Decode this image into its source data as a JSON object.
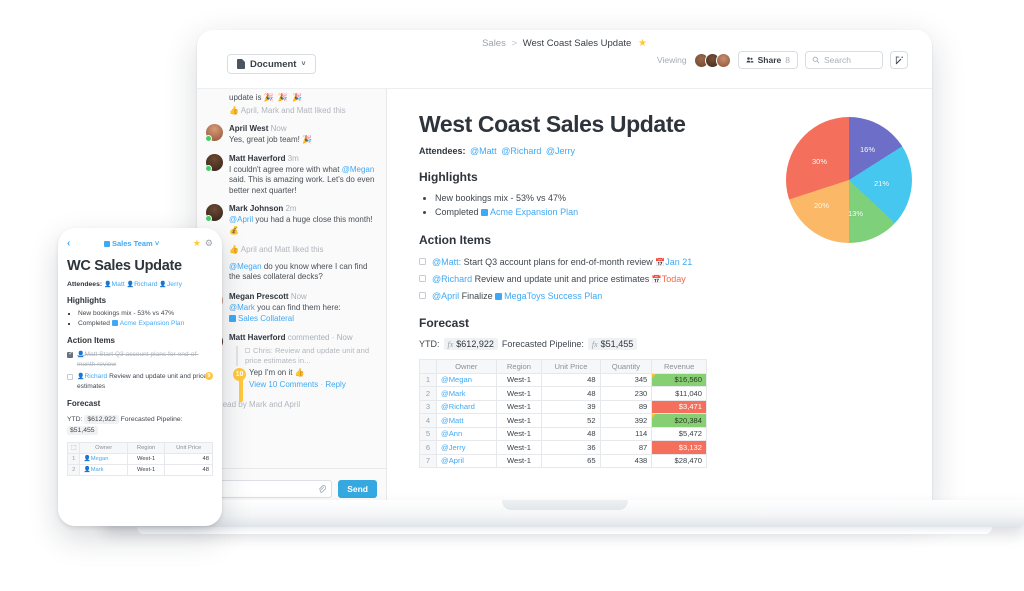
{
  "laptop": {
    "breadcrumb": {
      "root": "Sales",
      "separator": ">",
      "current": "West Coast Sales Update",
      "star": "★"
    },
    "doc_type_selector": {
      "label": "Document",
      "caret": "˅"
    },
    "toolbar": {
      "viewing_label": "Viewing",
      "share_label": "Share",
      "share_count": "8",
      "search_placeholder": "Search",
      "edit_icon": "compose-icon"
    },
    "chat": {
      "partial_message": {
        "text": "update is",
        "emoji": "🎉 🎉 🎉"
      },
      "partial_liked": "April, Mark and Matt liked this",
      "messages": [
        {
          "name": "April West",
          "time": "Now",
          "text": "Yes, great job team! 🎉",
          "avatar": "a-april"
        },
        {
          "name": "Matt Haverford",
          "time": "3m",
          "text_pre": "I couldn't agree more with what ",
          "mention": "@Megan",
          "text_post": " said. This is amazing work. Let's do even better next quarter!",
          "avatar": "a-matt"
        },
        {
          "name": "Mark Johnson",
          "time": "2m",
          "mention": "@April",
          "text_post": " you had a huge close this month! 💰",
          "liked": "April and Matt liked this",
          "followup_mention": "@Megan",
          "followup_text": " do you know where I can find the sales collateral decks?",
          "avatar": "a-mark"
        },
        {
          "name": "Megan Prescott",
          "time": "Now",
          "mention": "@Mark",
          "text_post": " you can find them here:",
          "link": "Sales Collateral",
          "avatar": "a-megan"
        },
        {
          "name": "Matt Haverford",
          "meta": "commented",
          "time": "Now",
          "quote": "Chris: Review and update unit and price estimates in...",
          "reply": "Yep I'm on it 👍",
          "badge": "10",
          "view_comments": "View 10 Comments",
          "reply_link": "Reply",
          "avatar": "a-matt"
        }
      ],
      "read_receipt": "Read by Mark and April",
      "input_placeholder": "",
      "attach_icon": "paperclip-icon",
      "send_label": "Send"
    },
    "document": {
      "title": "West Coast Sales Update",
      "attendees_label": "Attendees:",
      "attendees": [
        "@Matt",
        "@Richard",
        "@Jerry"
      ],
      "highlights_heading": "Highlights",
      "highlights": [
        {
          "text": "New bookings mix - 53% vs 47%"
        },
        {
          "text_pre": "Completed ",
          "link": "Acme Expansion Plan"
        }
      ],
      "action_items_heading": "Action Items",
      "action_items": [
        {
          "mention": "@Matt:",
          "text": " Start Q3 account plans for end-of-month review ",
          "due": "Jan 21",
          "due_style": "blue",
          "due_icon": "📅"
        },
        {
          "mention": "@Richard",
          "text": " Review and update unit and price estimates ",
          "due": "Today",
          "due_style": "red",
          "due_icon": "📅"
        },
        {
          "mention": "@April",
          "text": " Finalize ",
          "link": "MegaToys Success Plan"
        }
      ],
      "comment_badge": "10",
      "forecast_heading": "Forecast",
      "forecast": {
        "ytd_label": "YTD:",
        "ytd_value": "$612,922",
        "pipeline_label": "Forecasted Pipeline:",
        "pipeline_value": "$51,455",
        "fx_symbol": "fx"
      },
      "table": {
        "columns": [
          "Owner",
          "Region",
          "Unit Price",
          "Quantity",
          "Revenue"
        ],
        "rows": [
          {
            "n": "1",
            "owner": "@Megan",
            "region": "West-1",
            "unit_price": "48",
            "quantity": "345",
            "revenue": "$16,560",
            "revenue_style": "green"
          },
          {
            "n": "2",
            "owner": "@Mark",
            "region": "West-1",
            "unit_price": "48",
            "quantity": "230",
            "revenue": "$11,040",
            "revenue_style": "plain"
          },
          {
            "n": "3",
            "owner": "@Richard",
            "region": "West-1",
            "unit_price": "39",
            "quantity": "89",
            "revenue": "$3,471",
            "revenue_style": "red"
          },
          {
            "n": "4",
            "owner": "@Matt",
            "region": "West-1",
            "unit_price": "52",
            "quantity": "392",
            "revenue": "$20,384",
            "revenue_style": "green"
          },
          {
            "n": "5",
            "owner": "@Ann",
            "region": "West-1",
            "unit_price": "48",
            "quantity": "114",
            "revenue": "$5,472",
            "revenue_style": "plain"
          },
          {
            "n": "6",
            "owner": "@Jerry",
            "region": "West-1",
            "unit_price": "36",
            "quantity": "87",
            "revenue": "$3,132",
            "revenue_style": "red"
          },
          {
            "n": "7",
            "owner": "@April",
            "region": "West-1",
            "unit_price": "65",
            "quantity": "438",
            "revenue": "$28,470",
            "revenue_style": "plain"
          }
        ]
      }
    }
  },
  "phone": {
    "back_icon": "chevron-left-icon",
    "team_label": "Sales Team",
    "team_caret": "˅",
    "star_icon": "star-icon",
    "gear_icon": "gear-icon",
    "title": "WC Sales Update",
    "attendees_label": "Attendees:",
    "attendees": [
      "Matt",
      "Richard",
      "Jerry"
    ],
    "highlights_heading": "Highlights",
    "highlights": [
      {
        "text": "New bookings mix - 53% vs 47%"
      },
      {
        "text_pre": "Completed ",
        "link": "Acme Expansion Plan"
      }
    ],
    "action_items_heading": "Action Items",
    "action_items": [
      {
        "done": true,
        "person": "Matt",
        "text": "Start Q3 account plans for end-of-month review"
      },
      {
        "done": false,
        "person": "Richard",
        "text": "Review and update unit and price estimates",
        "badge": "9"
      }
    ],
    "forecast_heading": "Forecast",
    "forecast": {
      "ytd_label": "YTD:",
      "ytd_value": "$612,922",
      "pipeline_label": "Forecasted Pipeline:",
      "pipeline_value": "$51,455"
    },
    "table": {
      "columns": [
        "Owner",
        "Region",
        "Unit Price"
      ],
      "rows": [
        {
          "n": "1",
          "owner": "Megan",
          "region": "West-1",
          "unit_price": "48"
        },
        {
          "n": "2",
          "owner": "Mark",
          "region": "West-1",
          "unit_price": "48"
        }
      ]
    }
  },
  "chart_data": {
    "type": "pie",
    "title": "",
    "labels": [
      "Segment 1",
      "Segment 2",
      "Segment 3",
      "Segment 4",
      "Segment 5"
    ],
    "values": [
      16,
      21,
      13,
      20,
      30
    ],
    "value_labels": [
      "16%",
      "21%",
      "13%",
      "20%",
      "30%"
    ],
    "colors": [
      "#6d6ec7",
      "#45c7f0",
      "#7ed07a",
      "#fbb968",
      "#f4705c"
    ],
    "legend": "none",
    "units": "percent"
  }
}
